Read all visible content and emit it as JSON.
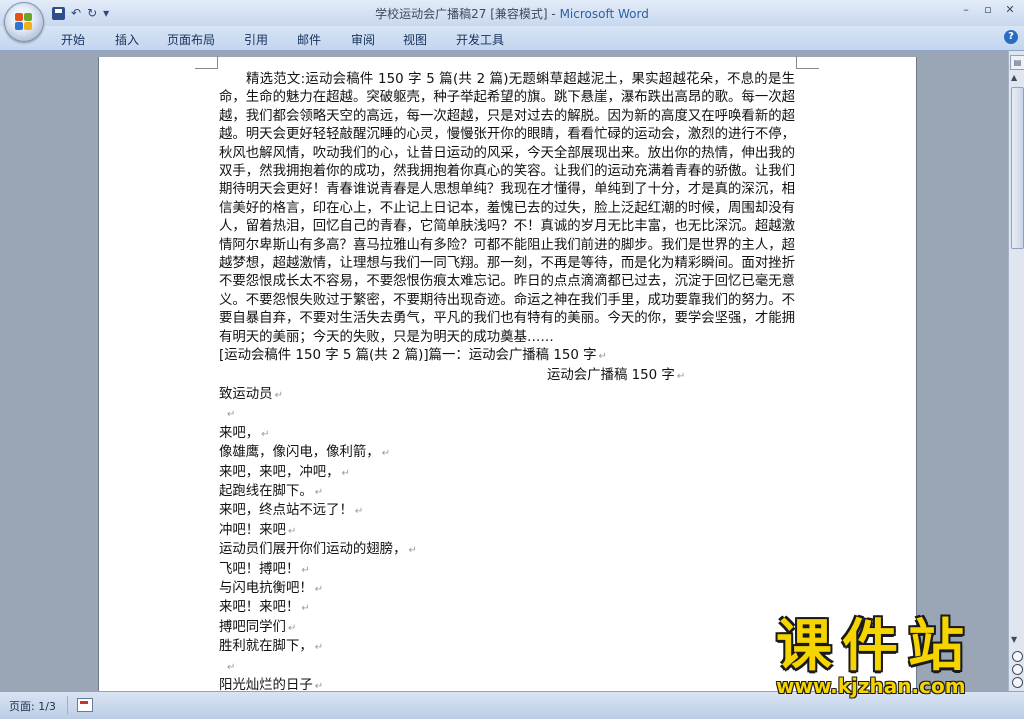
{
  "window": {
    "title_doc": "学校运动会广播稿27 [兼容模式] - ",
    "title_app": "Microsoft Word",
    "minimize": "–",
    "restore": "▫",
    "close": "✕"
  },
  "qat": {
    "undo": "↶",
    "redo": "↻",
    "customize": "▾"
  },
  "ribbon": {
    "tabs": [
      "开始",
      "插入",
      "页面布局",
      "引用",
      "邮件",
      "审阅",
      "视图",
      "开发工具"
    ],
    "help": "?"
  },
  "document": {
    "paragraph": "精选范文:运动会稿件 150 字 5 篇(共 2 篇)无题蝌草超越泥土，果实超越花朵，不息的是生命，生命的魅力在超越。突破躯壳，种子举起希望的旗。跳下悬崖，瀑布跌出高昂的歌。每一次超越，我们都会领略天空的高远，每一次超越，只是对过去的解脱。因为新的高度又在呼唤看新的超越。明天会更好轻轻敲醒沉睡的心灵，慢慢张开你的眼睛，看看忙碌的运动会，激烈的进行不停，秋风也解风情，吹动我们的心，让昔日运动的风采，今天全部展现出来。放出你的热情，伸出我的双手，然我拥抱着你的成功，然我拥抱着你真心的笑容。让我们的运动充满着青春的骄傲。让我们期待明天会更好！青春谁说青春是人思想单纯？我现在才懂得，单纯到了十分，才是真的深沉，相信美好的格言，印在心上，不止记上日记本，羞愧已去的过失，脸上泛起红潮的时候，周围却没有人，留着热泪，回忆自己的青春，它简单肤浅吗？不！真诚的岁月无比丰富，也无比深沉。超越激情阿尔卑斯山有多高？喜马拉雅山有多险？可都不能阻止我们前进的脚步。我们是世界的主人，超越梦想，超越激情，让理想与我们一同飞翔。那一刻，不再是等待，而是化为精彩瞬间。面对挫折不要怨恨成长太不容易，不要怨恨伤痕太难忘记。昨日的点点滴滴都已过去，沉淀于回忆已毫无意义。不要怨恨失败过于繁密，不要期待出现奇迹。命运之神在我们手里，成功要靠我们的努力。不要自暴自弃，不要对生活失去勇气，平凡的我们也有特有的美丽。今天的你，要学会坚强，才能拥有明天的美丽；今天的失败，只是为明天的成功奠基……",
    "heading": "[运动会稿件 150 字 5 篇(共 2 篇)]篇一：运动会广播稿 150 字",
    "subtitle": "运动会广播稿 150 字",
    "lines": [
      "致运动员",
      "",
      "来吧，",
      "像雄鹰，像闪电，像利箭，",
      "来吧，来吧，冲吧，",
      "起跑线在脚下。",
      "来吧，终点站不远了！",
      "冲吧！来吧",
      "运动员们展开你们运动的翅膀，",
      "飞吧！搏吧！",
      "与闪电抗衡吧！",
      "来吧！来吧！",
      "搏吧同学们",
      "胜利就在脚下，",
      "",
      "阳光灿烂的日子"
    ],
    "paragraph_mark": "↵"
  },
  "status_bar": {
    "page_indicator": "页面: 1/3"
  },
  "watermark": {
    "title": "课件站",
    "url": "www.kjzhan.com"
  },
  "colors": {
    "ribbon_bg": "#c3d5ee",
    "workspace_bg": "#9aa6b6",
    "title_app": "#2e5fa8",
    "watermark_fill": "#f5d400"
  }
}
